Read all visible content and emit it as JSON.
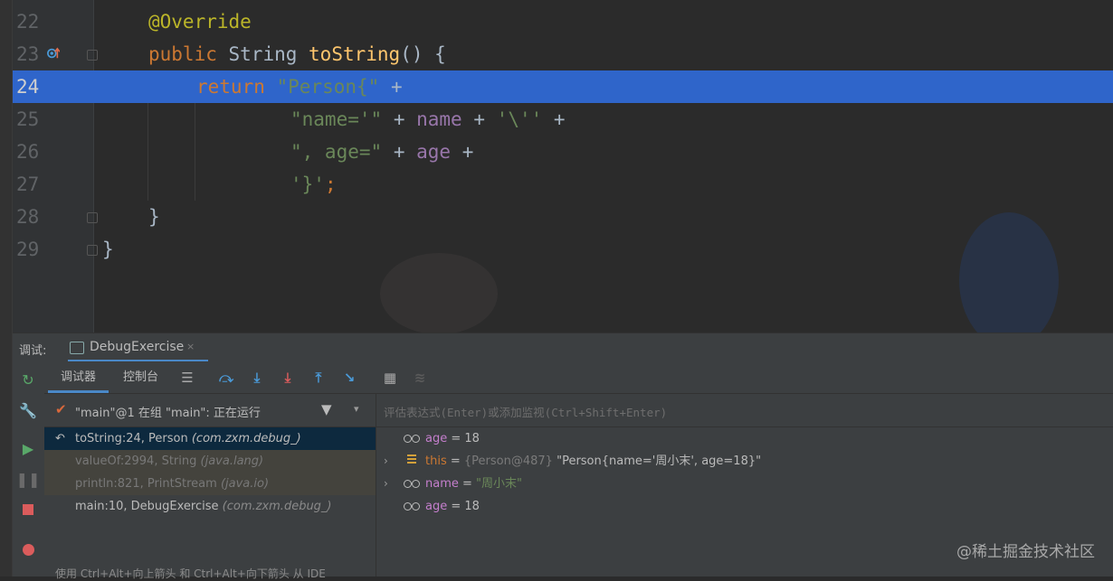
{
  "editor": {
    "lines": [
      {
        "num": "22",
        "current": false
      },
      {
        "num": "23",
        "current": false
      },
      {
        "num": "24",
        "current": true
      },
      {
        "num": "25",
        "current": false
      },
      {
        "num": "26",
        "current": false
      },
      {
        "num": "27",
        "current": false
      },
      {
        "num": "28",
        "current": false
      },
      {
        "num": "29",
        "current": false
      }
    ],
    "code": {
      "l22_annotation": "@Override",
      "l23_public": "public",
      "l23_type": "String",
      "l23_method": "toString",
      "l23_rest": "() {",
      "l24_return": "return",
      "l24_string": "\"Person{\"",
      "l24_plus": "+",
      "l25_str1": "\"name='\"",
      "l25_plus1": "+",
      "l25_field": "name",
      "l25_plus2": "+",
      "l25_str2": "'\\''",
      "l25_plus3": "+",
      "l26_str": "\", age=\"",
      "l26_plus1": "+",
      "l26_field": "age",
      "l26_plus2": "+",
      "l27_str": "'}'",
      "l27_semi": ";",
      "l28_brace": "}",
      "l29_brace": "}"
    }
  },
  "debug": {
    "header_label": "调试:",
    "tab_name": "DebugExercise",
    "tab_close": "×",
    "tabs": [
      "调试器",
      "控制台"
    ],
    "thread": "\"main\"@1 在组 \"main\": 正在运行",
    "frames": [
      {
        "method": "toString:24, Person",
        "pkg": "(com.zxm.debug_)",
        "selected": true,
        "lib": false
      },
      {
        "method": "valueOf:2994, String",
        "pkg": "(java.lang)",
        "selected": false,
        "lib": true
      },
      {
        "method": "println:821, PrintStream",
        "pkg": "(java.io)",
        "selected": false,
        "lib": true
      },
      {
        "method": "main:10, DebugExercise",
        "pkg": "(com.zxm.debug_)",
        "selected": false,
        "lib": false
      }
    ],
    "frames_hint": "使用 Ctrl+Alt+向上箭头 和 Ctrl+Alt+向下箭头 从 IDE",
    "watch_placeholder": "评估表达式(Enter)或添加监视(Ctrl+Shift+Enter)",
    "variables": [
      {
        "name": "age",
        "eq": " = ",
        "value": "18",
        "kind": "watch",
        "expand": ""
      },
      {
        "name": "this",
        "eq": " = ",
        "obj": "{Person@487}",
        "value": " \"Person{name='周小末', age=18}\"",
        "kind": "this",
        "expand": "›"
      },
      {
        "name": "name",
        "eq": " = ",
        "value": "\"周小末\"",
        "kind": "watch",
        "expand": "›"
      },
      {
        "name": "age",
        "eq": " = ",
        "value": "18",
        "kind": "watch",
        "expand": ""
      }
    ]
  },
  "watermark": "@稀土掘金技术社区",
  "colors": {
    "current_line": "#2f65ca",
    "keyword": "#cc7832",
    "string": "#6a8759",
    "field": "#9876aa",
    "method": "#ffc66d",
    "annotation": "#bbb529",
    "accent": "#4a88c7"
  }
}
